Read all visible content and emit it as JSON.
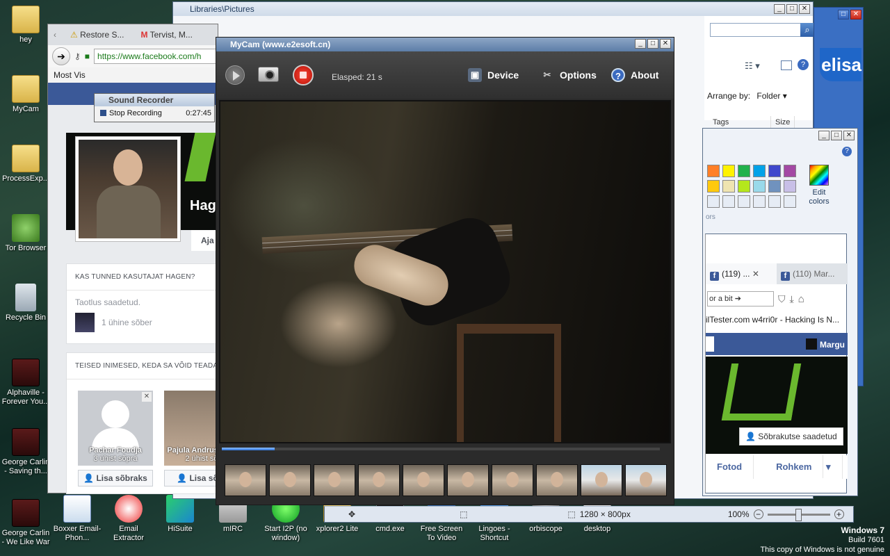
{
  "desktop": {
    "icons_left": [
      {
        "label": "hey",
        "kind": "folder"
      },
      {
        "label": "MyCam",
        "kind": "folder"
      },
      {
        "label": "ProcessExp...",
        "kind": "folder"
      },
      {
        "label": "Tor Browser",
        "kind": "tor"
      },
      {
        "label": "Recycle Bin",
        "kind": "bin"
      },
      {
        "label": "Alphaville - Forever You...",
        "kind": "video"
      },
      {
        "label": "George Carlin - Saving th...",
        "kind": "video"
      },
      {
        "label": "George Carlin - We Like War",
        "kind": "video"
      }
    ],
    "icons_bottom": [
      {
        "label": "Boxxer Email-Phon..."
      },
      {
        "label": "Email Extractor"
      },
      {
        "label": "HiSuite"
      },
      {
        "label": "mIRC"
      },
      {
        "label": "Start I2P (no window)"
      },
      {
        "label": "xplorer2 Lite"
      },
      {
        "label": "cmd.exe"
      },
      {
        "label": "Free Screen To Video"
      },
      {
        "label": "Lingoes - Shortcut"
      },
      {
        "label": "orbiscope"
      },
      {
        "label": "desktop"
      }
    ],
    "watermark": {
      "line1": "Windows 7",
      "line2": "Build 7601",
      "line3": "This copy of Windows is not genuine"
    }
  },
  "explorer": {
    "title": "Libraries\\Pictures",
    "arrange_label": "Arrange by:",
    "arrange_value": "Folder",
    "columns": [
      "Tags",
      "Size"
    ]
  },
  "elisa": {
    "logo": "elisa"
  },
  "paint": {
    "edit_colors": "Edit colors",
    "colors_label": "ors",
    "status_size": "1280 × 800px",
    "zoom": "100%"
  },
  "browser2": {
    "tabs": [
      "(119) ...",
      "(110) Mar..."
    ],
    "url_fragment": "or a bit",
    "bookmarks": "ilTester.com   w4rri0r - Hacking Is N...",
    "user_fragment": "Margu",
    "friend_request_sent": "Sõbrakutse saadetud",
    "nav": [
      "Fotod",
      "Rohkem"
    ]
  },
  "firefox": {
    "tabs": [
      "Restore S...",
      "Tervist, M..."
    ],
    "url": "https://www.facebook.com/h",
    "most_visited": "Most Vis",
    "profile_name_fragment": "Hag",
    "tab_fragment": "Aja",
    "card1_title": "KAS TUNNED KASUTAJAT HAGEN?",
    "card1_status": "Taotlus saadetud.",
    "card1_mutual": "1 ühine sõber",
    "card2_title": "TEISED INIMESED, KEDA SA VÕID TEADA",
    "suggestions": [
      {
        "name": "Pachar Foudja",
        "mutual": "3 ühist sõpra",
        "button": "Lisa sõbraks"
      },
      {
        "name": "Pajula Andrus Juta",
        "mutual": "2 ühist sõ",
        "button": "Lisa sõbr"
      }
    ]
  },
  "sound_recorder": {
    "title": "Sound Recorder",
    "action": "Stop Recording",
    "time": "0:27:45"
  },
  "mycam": {
    "title": "MyCam (www.e2esoft.cn)",
    "elapsed": "Elasped:  21 s",
    "menu": [
      {
        "label": "Device",
        "icon": "device-icon"
      },
      {
        "label": "Options",
        "icon": "tools-icon"
      },
      {
        "label": "About",
        "icon": "help-icon"
      }
    ],
    "progress_fraction": 0.12,
    "thumbnail_count": 10
  },
  "colors": {
    "fb_blue": "#3b5998",
    "rec_red": "#d0170c",
    "title_blue": "#5d7ea8"
  }
}
